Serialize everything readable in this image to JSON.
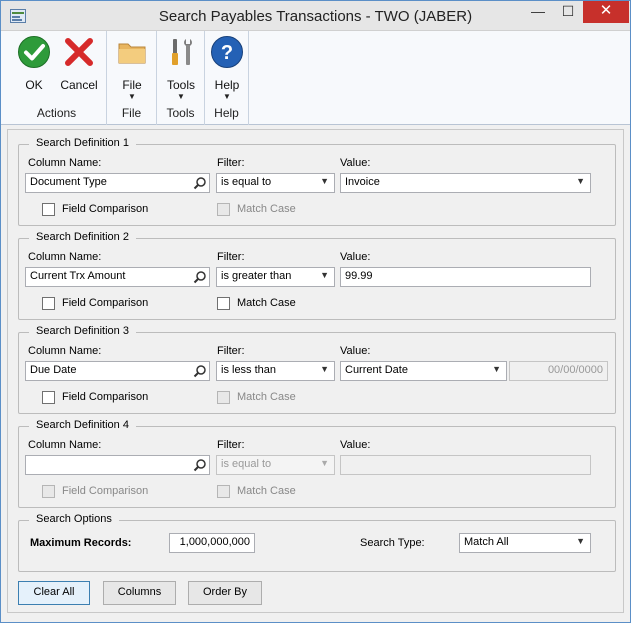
{
  "window": {
    "title": "Search Payables Transactions  -  TWO (JABER)",
    "minimize": "—",
    "maximize": "☐",
    "close": "✕"
  },
  "ribbon": {
    "groups": [
      {
        "label": "Actions",
        "buttons": [
          {
            "label": "OK",
            "icon": "check-icon"
          },
          {
            "label": "Cancel",
            "icon": "cancel-x-icon"
          }
        ]
      },
      {
        "label": "File",
        "buttons": [
          {
            "label": "File",
            "icon": "folder-icon"
          }
        ]
      },
      {
        "label": "Tools",
        "buttons": [
          {
            "label": "Tools",
            "icon": "tools-icon"
          }
        ]
      },
      {
        "label": "Help",
        "buttons": [
          {
            "label": "Help",
            "icon": "help-icon"
          }
        ]
      }
    ],
    "dropdown_arrow": "▼"
  },
  "labels": {
    "column_name": "Column Name:",
    "filter": "Filter:",
    "value": "Value:",
    "field_comparison": "Field Comparison",
    "match_case": "Match Case"
  },
  "definitions": [
    {
      "title": "Search Definition 1",
      "column": "Document Type",
      "filter": "is equal to",
      "value": "Invoice",
      "extra_value": "",
      "field_comparison": false,
      "match_case": false,
      "match_case_enabled": false
    },
    {
      "title": "Search Definition 2",
      "column": "Current Trx Amount",
      "filter": "is greater than",
      "value": "99.99",
      "extra_value": "",
      "field_comparison": false,
      "match_case": false,
      "match_case_enabled": true
    },
    {
      "title": "Search Definition 3",
      "column": "Due Date",
      "filter": "is less than",
      "value": "Current Date",
      "extra_value": "00/00/0000",
      "field_comparison": false,
      "match_case": false,
      "match_case_enabled": false
    },
    {
      "title": "Search Definition 4",
      "column": "",
      "filter": "is equal to",
      "value": "",
      "extra_value": "",
      "field_comparison": false,
      "match_case": false,
      "match_case_enabled": false
    }
  ],
  "search_options": {
    "title": "Search Options",
    "max_records_label": "Maximum Records:",
    "max_records_value": "1,000,000,000",
    "search_type_label": "Search Type:",
    "search_type_value": "Match All"
  },
  "buttons": {
    "clear_all": "Clear All",
    "columns": "Columns",
    "order_by": "Order By"
  },
  "colors": {
    "accent": "#3c7fb1",
    "close": "#c7302b",
    "ok_green": "#2e9b3a",
    "cancel_red": "#d62a2a",
    "help_blue": "#2461b5"
  }
}
